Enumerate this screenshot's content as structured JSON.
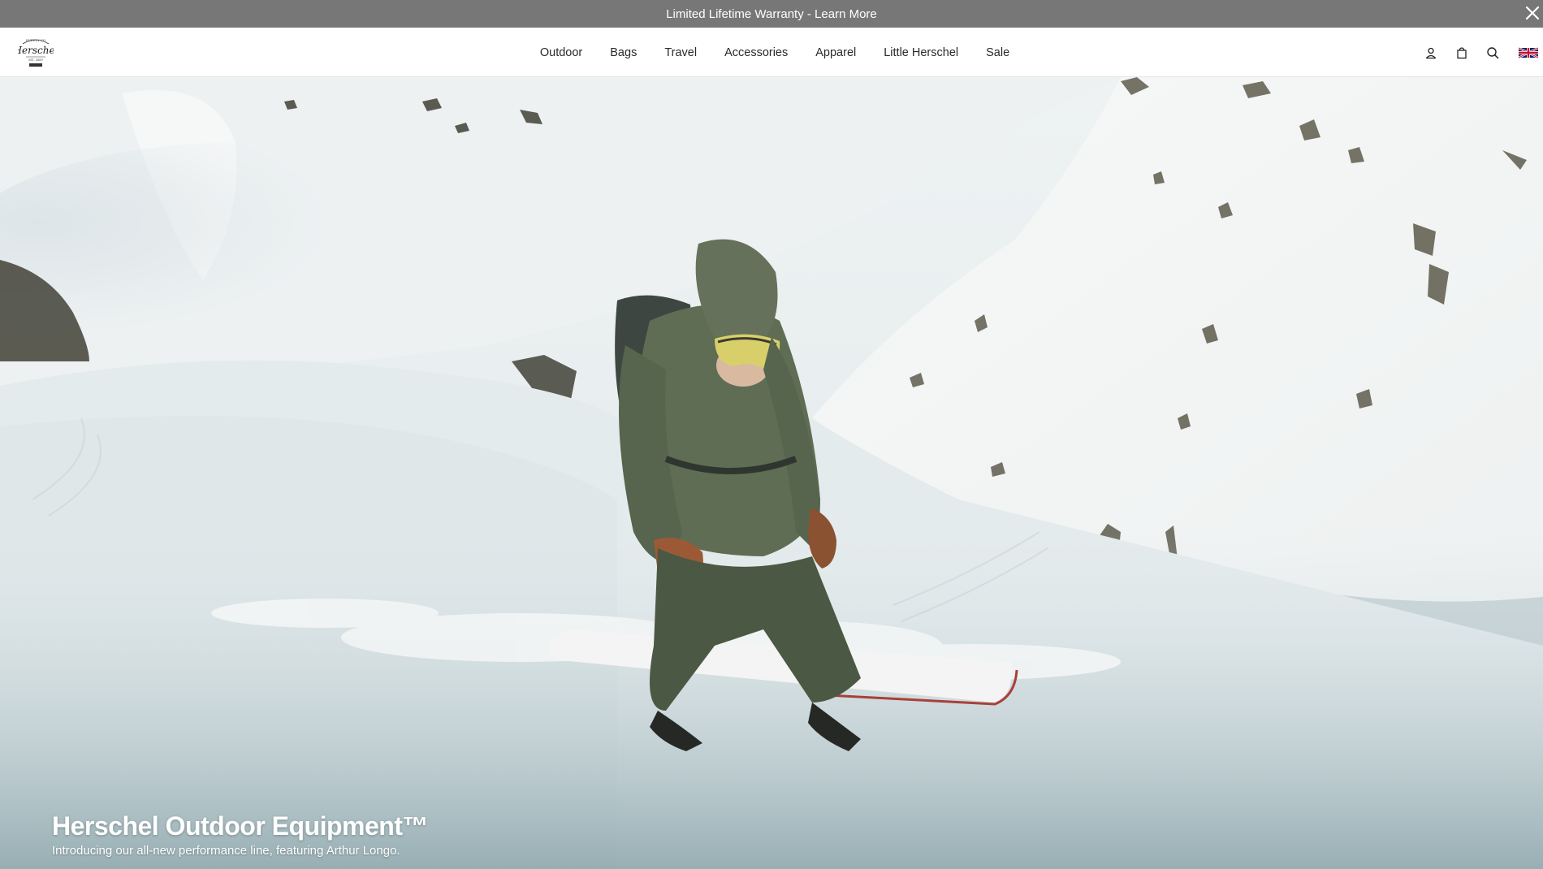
{
  "announcement": {
    "text": "Limited Lifetime Warranty - Learn More",
    "close_icon": "close-icon"
  },
  "header": {
    "logo_alt": "Herschel",
    "nav": [
      {
        "label": "Outdoor"
      },
      {
        "label": "Bags"
      },
      {
        "label": "Travel"
      },
      {
        "label": "Accessories"
      },
      {
        "label": "Apparel"
      },
      {
        "label": "Little Herschel"
      },
      {
        "label": "Sale"
      }
    ],
    "icons": [
      "account-icon",
      "cart-icon",
      "search-icon",
      "uk-flag-icon"
    ]
  },
  "hero": {
    "title": "Herschel Outdoor Equipment™",
    "subtitle": "Introducing our all-new performance line, featuring Arthur Longo."
  },
  "colors": {
    "announcement_bg": "#777777",
    "header_bg": "#ffffff",
    "hero_text": "#ffffff"
  }
}
